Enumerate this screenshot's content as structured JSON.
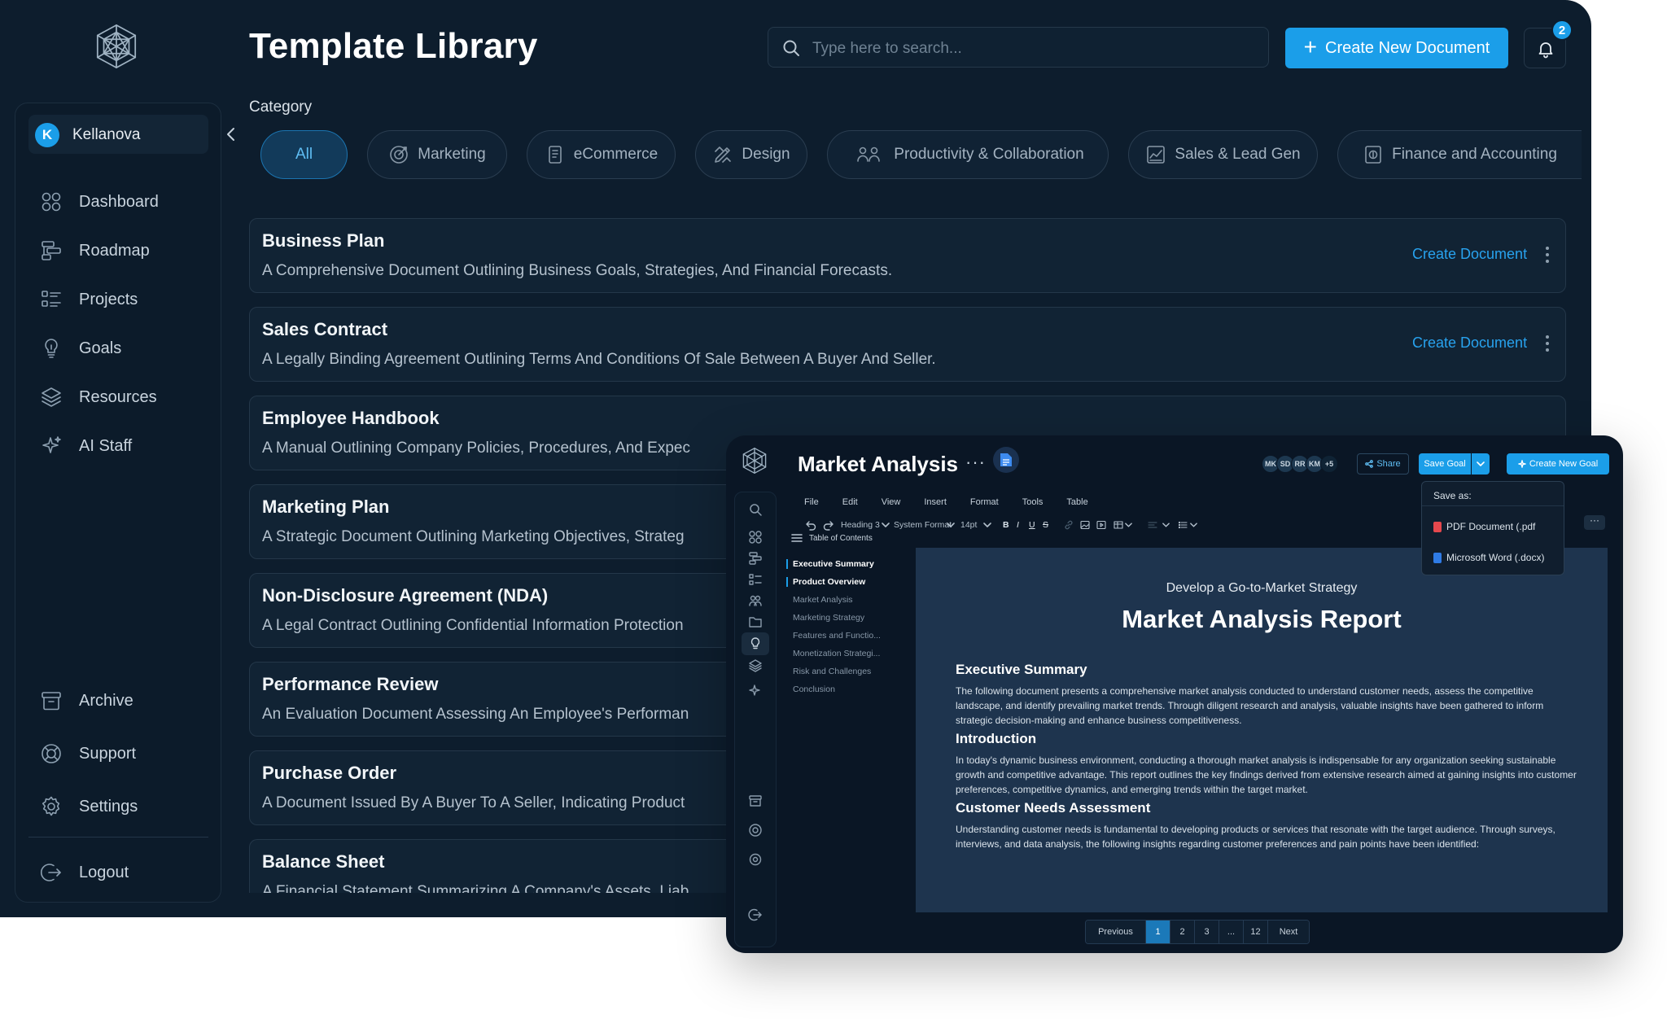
{
  "header": {
    "title": "Template Library",
    "search_placeholder": "Type here to search...",
    "create_button": "Create New Document",
    "notification_count": "2"
  },
  "workspace": {
    "initial": "K",
    "name": "Kellanova"
  },
  "sidebar": {
    "items": [
      {
        "label": "Dashboard",
        "icon": "dashboard-icon"
      },
      {
        "label": "Roadmap",
        "icon": "roadmap-icon"
      },
      {
        "label": "Projects",
        "icon": "projects-icon"
      },
      {
        "label": "Goals",
        "icon": "goals-icon"
      },
      {
        "label": "Resources",
        "icon": "resources-icon"
      },
      {
        "label": "AI Staff",
        "icon": "ai-sparkle-icon"
      }
    ],
    "bottom_items": [
      {
        "label": "Archive",
        "icon": "archive-icon"
      },
      {
        "label": "Support",
        "icon": "support-icon"
      },
      {
        "label": "Settings",
        "icon": "gear-icon"
      }
    ],
    "logout": "Logout"
  },
  "category": {
    "label": "Category",
    "chips": [
      "All",
      "Marketing",
      "eCommerce",
      "Design",
      "Productivity & Collaboration",
      "Sales & Lead Gen",
      "Finance and Accounting"
    ],
    "active": "All"
  },
  "templates": [
    {
      "title": "Business Plan",
      "desc": "A Comprehensive Document Outlining Business Goals, Strategies, And Financial Forecasts.",
      "action": "Create Document"
    },
    {
      "title": "Sales Contract",
      "desc": "A Legally Binding Agreement Outlining Terms And Conditions Of Sale Between A Buyer And Seller.",
      "action": "Create Document"
    },
    {
      "title": "Employee Handbook",
      "desc": "A Manual Outlining Company Policies, Procedures, And Expec"
    },
    {
      "title": "Marketing Plan",
      "desc": "A Strategic Document Outlining Marketing Objectives, Strateg"
    },
    {
      "title": "Non-Disclosure Agreement (NDA)",
      "desc": "A Legal Contract Outlining Confidential Information Protection"
    },
    {
      "title": "Performance Review",
      "desc": "An Evaluation Document Assessing An Employee's Performan"
    },
    {
      "title": "Purchase Order",
      "desc": "A Document Issued By A Buyer To A Seller, Indicating Product"
    },
    {
      "title": "Balance Sheet",
      "desc": "A Financial Statement Summarizing A Company's Assets, Liab"
    }
  ],
  "editor": {
    "title": "Market Analysis",
    "more": "···",
    "collaborators": [
      "MK",
      "SD",
      "RR",
      "KM",
      "+5"
    ],
    "share": "Share",
    "save_goal": "Save Goal",
    "create_goal": "Create New Goal",
    "menu": [
      "File",
      "Edit",
      "View",
      "Insert",
      "Format",
      "Tools",
      "Table"
    ],
    "toolbar": {
      "heading": "Heading 3",
      "font": "System Format",
      "size": "14pt"
    },
    "toc_title": "Table of Contents",
    "toc": [
      "Executive Summary",
      "Product Overview",
      "Market Analysis",
      "Marketing Strategy",
      "Features and Functio...",
      "Monetization Strategi...",
      "Risk and Challenges",
      "Conclusion"
    ],
    "doc": {
      "subtitle": "Develop a Go-to-Market Strategy",
      "title": "Market Analysis Report",
      "sections": [
        {
          "heading": "Executive Summary",
          "body": "The following document presents a comprehensive market analysis conducted to understand customer needs, assess the competitive landscape, and identify prevailing market trends. Through diligent research and analysis, valuable insights have been gathered to inform strategic decision-making and enhance business competitiveness."
        },
        {
          "heading": "Introduction",
          "body": "In today's dynamic business environment, conducting a thorough market analysis is indispensable for any organization seeking sustainable growth and competitive advantage. This report outlines the key findings derived from extensive research aimed at gaining insights into customer preferences, competitive dynamics, and emerging trends within the target market."
        },
        {
          "heading": "Customer Needs Assessment",
          "body": "Understanding customer needs is fundamental to developing products or services that resonate with the target audience. Through surveys, interviews, and data analysis, the following insights regarding customer preferences and pain points have been identified:"
        }
      ]
    },
    "pagination": [
      "Previous",
      "1",
      "2",
      "3",
      "...",
      "12",
      "Next"
    ],
    "save_as": {
      "label": "Save as:",
      "options": [
        "PDF Document (.pdf",
        "Microsoft Word (.docx)"
      ]
    }
  },
  "colors": {
    "accent": "#1b9ee9",
    "background": "#0d1d2d",
    "card": "#112334"
  }
}
